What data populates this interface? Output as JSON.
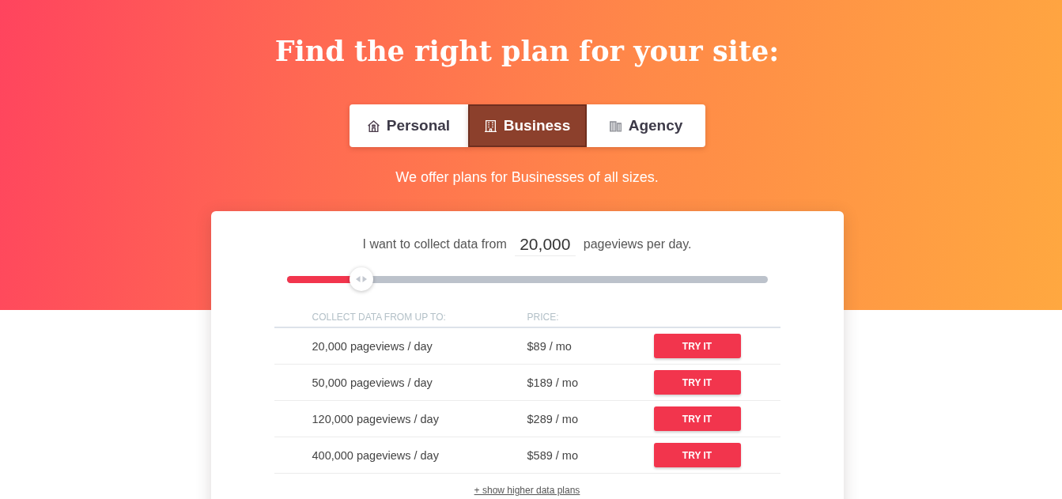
{
  "hero": {
    "title": "Find the right plan for your site:",
    "tabs": [
      {
        "label": "Personal",
        "selected": false
      },
      {
        "label": "Business",
        "selected": true
      },
      {
        "label": "Agency",
        "selected": false
      }
    ],
    "subtitle": "We offer plans for Businesses of all sizes."
  },
  "calculator": {
    "text_before": "I want to collect data from",
    "pageviews": "20,000",
    "text_after": "pageviews per day.",
    "slider": {
      "level": 0.156
    }
  },
  "table": {
    "columns": [
      "COLLECT DATA FROM UP TO:",
      "PRICE:"
    ],
    "rows": [
      {
        "pageviews": "20,000 pageviews / day",
        "price": "$89 / mo",
        "button": "TRY IT"
      },
      {
        "pageviews": "50,000 pageviews / day",
        "price": "$189 / mo",
        "button": "TRY IT"
      },
      {
        "pageviews": "120,000 pageviews / day",
        "price": "$289 / mo",
        "button": "TRY IT"
      },
      {
        "pageviews": "400,000 pageviews / day",
        "price": "$589 / mo",
        "button": "TRY IT"
      }
    ]
  },
  "more_link": "+ show higher data plans"
}
